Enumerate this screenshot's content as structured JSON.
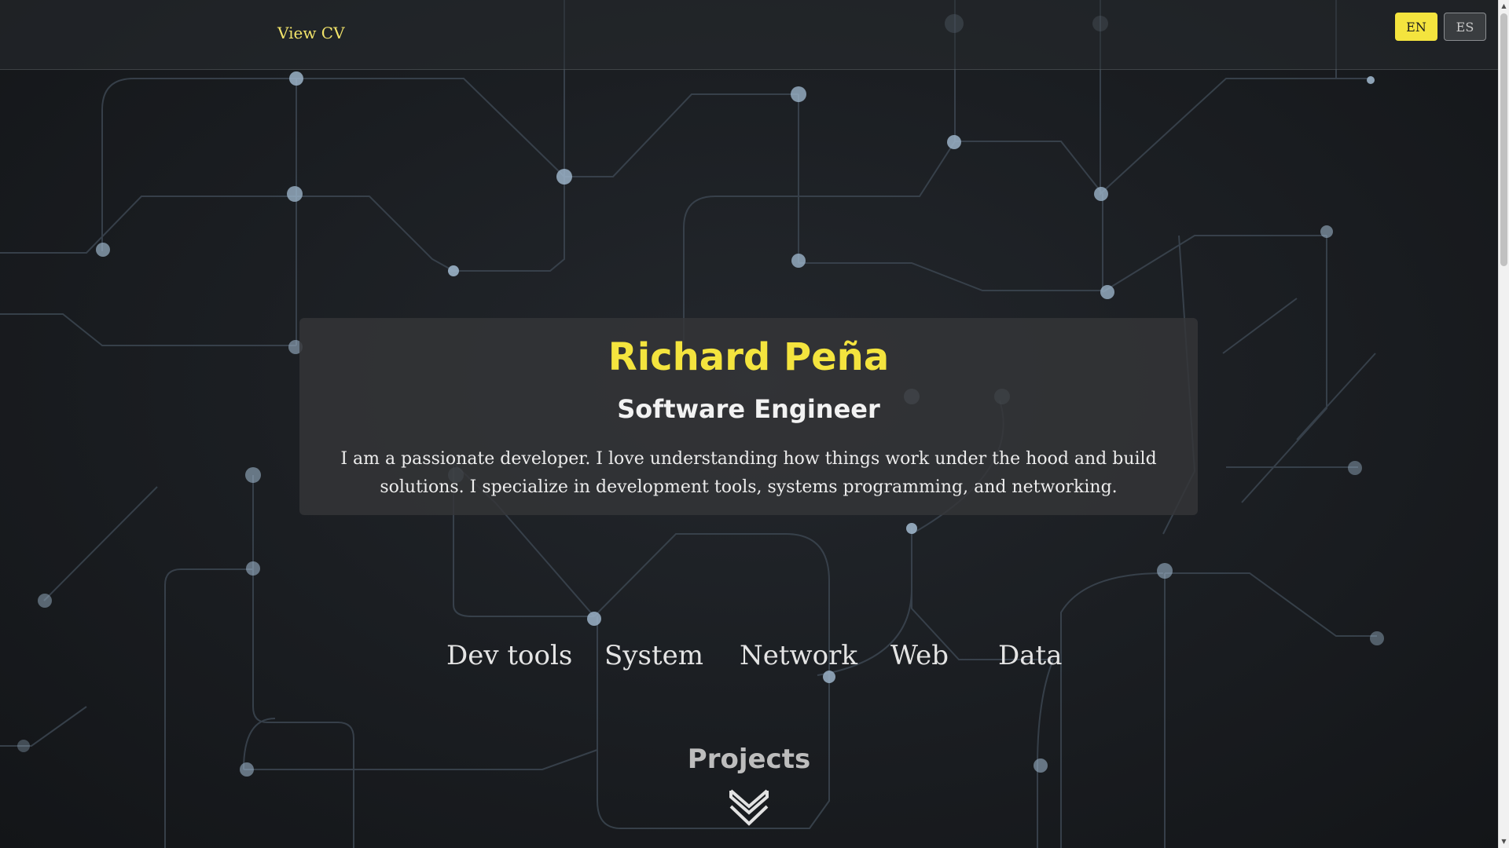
{
  "header": {
    "cv_link": "View CV",
    "languages": [
      "EN",
      "ES"
    ],
    "active_language": "EN"
  },
  "hero": {
    "name": "Richard Peña",
    "role": "Software Engineer",
    "bio": "I am a passionate developer. I love understanding how things work under the hood and build solutions. I specialize in development tools, systems programming, and networking."
  },
  "skills": [
    "Dev tools",
    "System",
    "Network",
    "Web",
    "Data"
  ],
  "projects": {
    "title": "Projects",
    "icon": "double-chevron-down-icon"
  },
  "colors": {
    "accent": "#f4e43e",
    "background": "#1a1d21",
    "card": "#343638",
    "circuit_line": "#3d4650",
    "circuit_node": "#9bb3c8"
  }
}
